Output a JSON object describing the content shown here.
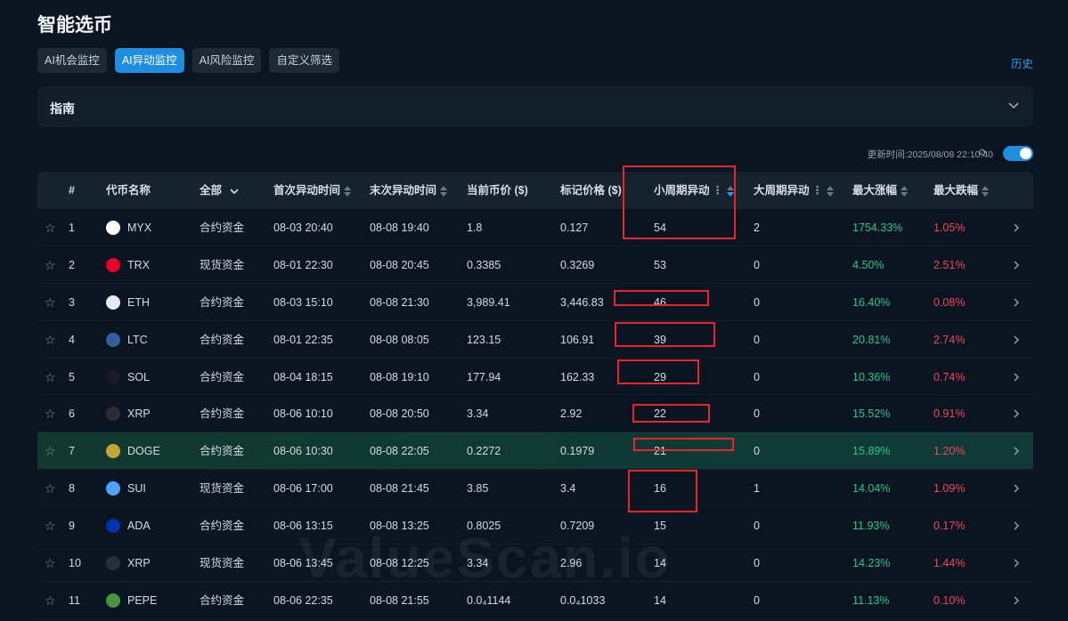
{
  "page": {
    "title": "智能选币",
    "history_label": "历史"
  },
  "tabs": [
    {
      "label": "AI机会监控",
      "active": false
    },
    {
      "label": "AI异动监控",
      "active": true
    },
    {
      "label": "AI风险监控",
      "active": false
    },
    {
      "label": "自定义筛选",
      "active": false
    }
  ],
  "guide": {
    "label": "指南"
  },
  "update": {
    "text": "更新时间:2025/08/08 22:10:40",
    "toggle_on": true
  },
  "table": {
    "headers": {
      "index": "#",
      "name": "代币名称",
      "filter": "全部",
      "first_time": "首次异动时间",
      "last_time": "末次异动时间",
      "price": "当前币价 ($)",
      "mark_price": "标记价格 ($)",
      "small_cycle": "小周期异动",
      "big_cycle": "大周期异动",
      "max_gain": "最大涨幅",
      "max_drop": "最大跌幅"
    },
    "rows": [
      {
        "index": "1",
        "coin": "MYX",
        "icon": "myx-icon",
        "color": "#ffffff",
        "type": "合约资金",
        "first": "08-03 20:40",
        "last": "08-08 19:40",
        "price": "1.8",
        "mark": "0.127",
        "small": "54",
        "big": "2",
        "gain": "1754.33%",
        "drop": "1.05%"
      },
      {
        "index": "2",
        "coin": "TRX",
        "icon": "trx-icon",
        "color": "#eb0029",
        "type": "现货资金",
        "first": "08-01 22:30",
        "last": "08-08 20:45",
        "price": "0.3385",
        "mark": "0.3269",
        "small": "53",
        "big": "0",
        "gain": "4.50%",
        "drop": "2.51%"
      },
      {
        "index": "3",
        "coin": "ETH",
        "icon": "eth-icon",
        "color": "#e6e9ee",
        "type": "合约资金",
        "first": "08-03 15:10",
        "last": "08-08 21:30",
        "price": "3,989.41",
        "mark": "3,446.83",
        "small": "46",
        "big": "0",
        "gain": "16.40%",
        "drop": "0.08%"
      },
      {
        "index": "4",
        "coin": "LTC",
        "icon": "ltc-icon",
        "color": "#345d9d",
        "type": "合约资金",
        "first": "08-01 22:35",
        "last": "08-08 08:05",
        "price": "123.15",
        "mark": "106.91",
        "small": "39",
        "big": "0",
        "gain": "20.81%",
        "drop": "2.74%"
      },
      {
        "index": "5",
        "coin": "SOL",
        "icon": "sol-icon",
        "color": "#1b1b25",
        "type": "合约资金",
        "first": "08-04 18:15",
        "last": "08-08 19:10",
        "price": "177.94",
        "mark": "162.33",
        "small": "29",
        "big": "0",
        "gain": "10.36%",
        "drop": "0.74%"
      },
      {
        "index": "6",
        "coin": "XRP",
        "icon": "xrp-icon",
        "color": "#2a2f36",
        "type": "合约资金",
        "first": "08-06 10:10",
        "last": "08-08 20:50",
        "price": "3.34",
        "mark": "2.92",
        "small": "22",
        "big": "0",
        "gain": "15.52%",
        "drop": "0.91%"
      },
      {
        "index": "7",
        "coin": "DOGE",
        "icon": "doge-icon",
        "color": "#c2a633",
        "type": "合约资金",
        "first": "08-06 10:30",
        "last": "08-08 22:05",
        "price": "0.2272",
        "mark": "0.1979",
        "small": "21",
        "big": "0",
        "gain": "15.89%",
        "drop": "1.20%"
      },
      {
        "index": "8",
        "coin": "SUI",
        "icon": "sui-icon",
        "color": "#4da2ff",
        "type": "现货资金",
        "first": "08-06 17:00",
        "last": "08-08 21:45",
        "price": "3.85",
        "mark": "3.4",
        "small": "16",
        "big": "1",
        "gain": "14.04%",
        "drop": "1.09%"
      },
      {
        "index": "9",
        "coin": "ADA",
        "icon": "ada-icon",
        "color": "#0033ad",
        "type": "合约资金",
        "first": "08-06 13:15",
        "last": "08-08 13:25",
        "price": "0.8025",
        "mark": "0.7209",
        "small": "15",
        "big": "0",
        "gain": "11.93%",
        "drop": "0.17%"
      },
      {
        "index": "10",
        "coin": "XRP",
        "icon": "xrp-icon",
        "color": "#2a2f36",
        "type": "现货资金",
        "first": "08-06 13:45",
        "last": "08-08 12:25",
        "price": "3.34",
        "mark": "2.96",
        "small": "14",
        "big": "0",
        "gain": "14.23%",
        "drop": "1.44%"
      },
      {
        "index": "11",
        "coin": "PEPE",
        "icon": "pepe-icon",
        "color": "#4c9540",
        "type": "合约资金",
        "first": "08-06 22:35",
        "last": "08-08 21:55",
        "price": "0.0₄1144",
        "mark": "0.0₄1033",
        "small": "14",
        "big": "0",
        "gain": "11.13%",
        "drop": "0.10%"
      }
    ]
  },
  "watermark": "ValueScan.io"
}
